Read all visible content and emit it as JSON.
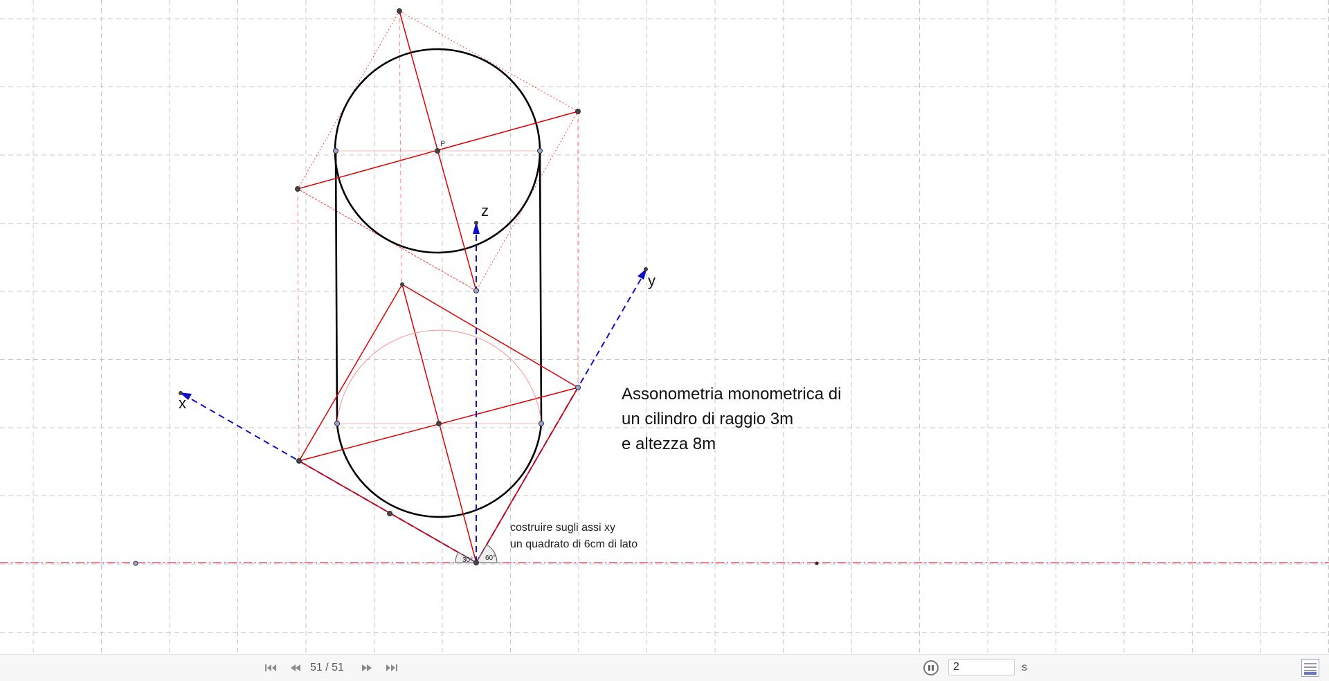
{
  "construction": {
    "description_lines": [
      "Assonometria monometrica di",
      "un cilindro di raggio 3m",
      "e altezza 8m"
    ],
    "hint_lines": [
      "costruire sugli assi xy",
      "un quadrato di 6cm di lato"
    ],
    "axis_labels": {
      "x": "x",
      "y": "y",
      "z": "z"
    },
    "point_label": "P",
    "angles": {
      "left": "30°",
      "right": "60°"
    },
    "colors": {
      "grid": "#c8c8c8",
      "construction": "#e00000",
      "axis": "#1010c8",
      "cylinder": "#000000"
    }
  },
  "toolbar": {
    "step_counter": "51 / 51",
    "speed_value": "2",
    "speed_unit": "s",
    "buttons": [
      "first-step-icon",
      "previous-step-icon",
      "next-step-icon",
      "last-step-icon",
      "pause-icon",
      "algebra-view-icon"
    ]
  }
}
